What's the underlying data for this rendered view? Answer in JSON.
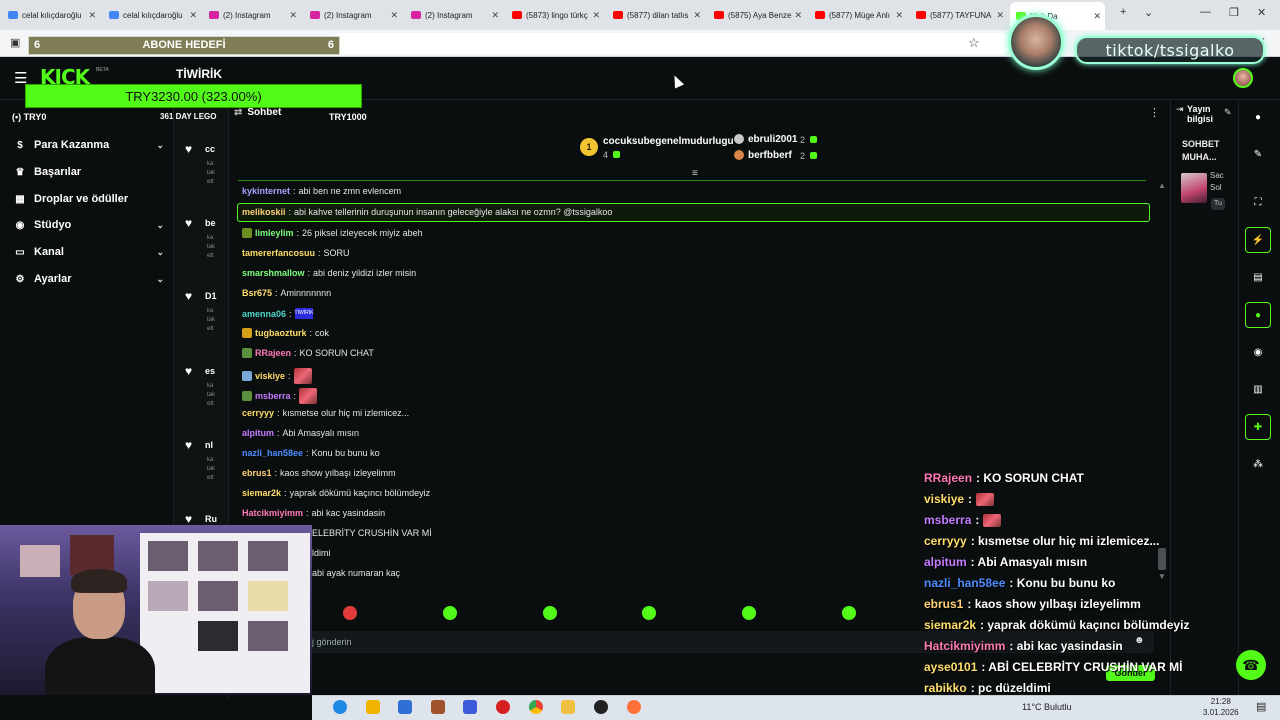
{
  "browser": {
    "tabs": [
      {
        "label": "celal kılıçdaroğlu",
        "fav": "#4285f4"
      },
      {
        "label": "celal kılıçdaroğlu",
        "fav": "#4285f4"
      },
      {
        "label": "(2) Instagram",
        "fav": "#d6249f"
      },
      {
        "label": "(2) Instagram",
        "fav": "#d6249f"
      },
      {
        "label": "(2) Instagram",
        "fav": "#d6249f"
      },
      {
        "label": "(5873) lingo türkç",
        "fav": "#ff0000"
      },
      {
        "label": "(5877) dilan tatlıs",
        "fav": "#ff0000"
      },
      {
        "label": "(5875) Aya Benze",
        "fav": "#ff0000"
      },
      {
        "label": "(5877) Müge Anlı",
        "fav": "#ff0000"
      },
      {
        "label": "(5877) TAYFUNA",
        "fav": "#ff0000"
      },
      {
        "label": "Kick Da",
        "fav": "#53fc18"
      }
    ]
  },
  "overlays": {
    "abone_left": "6",
    "abone_title": "ABONE HEDEFİ",
    "abone_right": "6",
    "twirk": "TİWİRİK",
    "goal_text": "TRY3230.00 (323.00%)",
    "try_left": "TRY0",
    "try_mid": "361 DAY LEGO",
    "try_right": "TRY1000",
    "tiktok": "tiktok/tssigalko"
  },
  "header": {
    "logo": "KICK",
    "beta": "BETA"
  },
  "sidebar": {
    "items": [
      {
        "label": "Para Kazanma",
        "icon": "$",
        "chevron": true
      },
      {
        "label": "Başarılar",
        "icon": "♛",
        "chevron": false
      },
      {
        "label": "Droplar ve ödüller",
        "icon": "▦",
        "chevron": false
      },
      {
        "label": "Stüdyo",
        "icon": "◉",
        "chevron": true
      },
      {
        "label": "Kanal",
        "icon": "▭",
        "chevron": true
      },
      {
        "label": "Ayarlar",
        "icon": "⚙",
        "chevron": true
      }
    ]
  },
  "recommended": [
    {
      "code": "cc",
      "sub": "ka\ntak\nett"
    },
    {
      "code": "be",
      "sub": "ka\ntak\nett"
    },
    {
      "code": "D1",
      "sub": "ka\ntak\nett"
    },
    {
      "code": "es",
      "sub": "ka\ntak\nett"
    },
    {
      "code": "nl",
      "sub": "ka\ntak\nett"
    },
    {
      "code": "Ru",
      "sub": ""
    }
  ],
  "chat": {
    "title": "Sohbet",
    "leaders": {
      "first": {
        "name": "cocuksubegenelmudurlugu",
        "count": "4",
        "rank": "1"
      },
      "second": {
        "name": "ebruli2001",
        "count": "2"
      },
      "third": {
        "name": "berfbberf",
        "count": "2"
      }
    },
    "messages": [
      {
        "user": "kykinternet",
        "color": "#a3a3ff",
        "text": "abi ben ne zmn evlencem"
      },
      {
        "user": "melikoskii",
        "color": "#ffd27a",
        "text": "abi kahve tellerinin duruşunun insanın geleceğiyle alaksı ne ozmn? @tssigalkoo"
      },
      {
        "user": "limleylim",
        "color": "#7dff7d",
        "text": "26 piksel izleyecek miyiz abeh"
      },
      {
        "user": "tamererfancosuu",
        "color": "#ffdf6b",
        "text": "SORU"
      },
      {
        "user": "smarshmallow",
        "color": "#7dff7d",
        "text": "abi deniz yildizi izler misin"
      },
      {
        "user": "Bsr675",
        "color": "#ffdf6b",
        "text": "Aminnnnnnn"
      },
      {
        "user": "amenna06",
        "color": "#4fd6c9",
        "text": ""
      },
      {
        "user": "tugbaozturk",
        "color": "#ffdf6b",
        "text": "cok"
      },
      {
        "user": "RRajeen",
        "color": "#ff7ab6",
        "text": "KO SORUN CHAT"
      },
      {
        "user": "viskiye",
        "color": "#ffdf6b",
        "text": ""
      },
      {
        "user": "msberra",
        "color": "#c67cff",
        "text": ""
      },
      {
        "user": "cerryyy",
        "color": "#ffdf6b",
        "text": "kısmetse olur hiç mi izlemicez..."
      },
      {
        "user": "alpitum",
        "color": "#c67cff",
        "text": "Abi Amasyalı mısın"
      },
      {
        "user": "nazli_han58ee",
        "color": "#4d8cff",
        "text": "Konu bu bunu ko"
      },
      {
        "user": "ebrus1",
        "color": "#ffd27a",
        "text": "kaos show yılbaşı izleyelimm"
      },
      {
        "user": "siemar2k",
        "color": "#ffdf6b",
        "text": "yaprak dökümü kaçıncı bölümdeyiz"
      },
      {
        "user": "Hatcikmiyimm",
        "color": "#ff7ab6",
        "text": "abi kac yasindasin"
      },
      {
        "user": "",
        "color": "#ffffff",
        "text": "ELEBRİTY CRUSHİN VAR Mİ"
      },
      {
        "user": "",
        "color": "#ffffff",
        "text": "ldimi"
      },
      {
        "user": "",
        "color": "#ffffff",
        "text": "abi ayak numaran kaç"
      }
    ],
    "emote_label": "TİWİRİK",
    "input_placeholder": "j gönderin",
    "send_label": "Gönder"
  },
  "right_panel": {
    "title": "Yayın bilgisi",
    "section": "SOHBET MUHA...",
    "thumb_text": "Sac\nSol",
    "tag": "Tu"
  },
  "overlay_chat": [
    {
      "user": "RRajeen",
      "color": "#ff7ab6",
      "text": ": KO SORUN CHAT",
      "emote": false
    },
    {
      "user": "viskiye",
      "color": "#ffdf6b",
      "text": ":",
      "emote": true
    },
    {
      "user": "msberra",
      "color": "#c67cff",
      "text": ":",
      "emote": true
    },
    {
      "user": "cerryyy",
      "color": "#ffdf6b",
      "text": ": kısmetse olur hiç mi izlemicez...",
      "emote": false
    },
    {
      "user": "alpitum",
      "color": "#c67cff",
      "text": ": Abi Amasyalı mısın",
      "emote": false
    },
    {
      "user": "nazli_han58ee",
      "color": "#4d8cff",
      "text": ": Konu bu bunu ko",
      "emote": false
    },
    {
      "user": "ebrus1",
      "color": "#ffd27a",
      "text": ": kaos show yılbaşı izleyelimm",
      "emote": false
    },
    {
      "user": "siemar2k",
      "color": "#ffdf6b",
      "text": ": yaprak dökümü kaçıncı bölümdeyiz",
      "emote": false
    },
    {
      "user": "Hatcikmiyimm",
      "color": "#ff7ab6",
      "text": ": abi kac yasindasin",
      "emote": false
    },
    {
      "user": "ayse0101",
      "color": "#ffdf6b",
      "text": ": ABİ CELEBRİTY CRUSHİN VAR Mİ",
      "emote": false
    },
    {
      "user": "rabikko",
      "color": "#ffdf6b",
      "text": ": pc düzeldimi",
      "emote": false
    }
  ],
  "taskbar": {
    "weather": "11°C  Bulutlu",
    "time": "21:28",
    "date": "3.01.2026"
  },
  "colors": {
    "kick_green": "#53fc18",
    "bg": "#0b0e0f"
  }
}
